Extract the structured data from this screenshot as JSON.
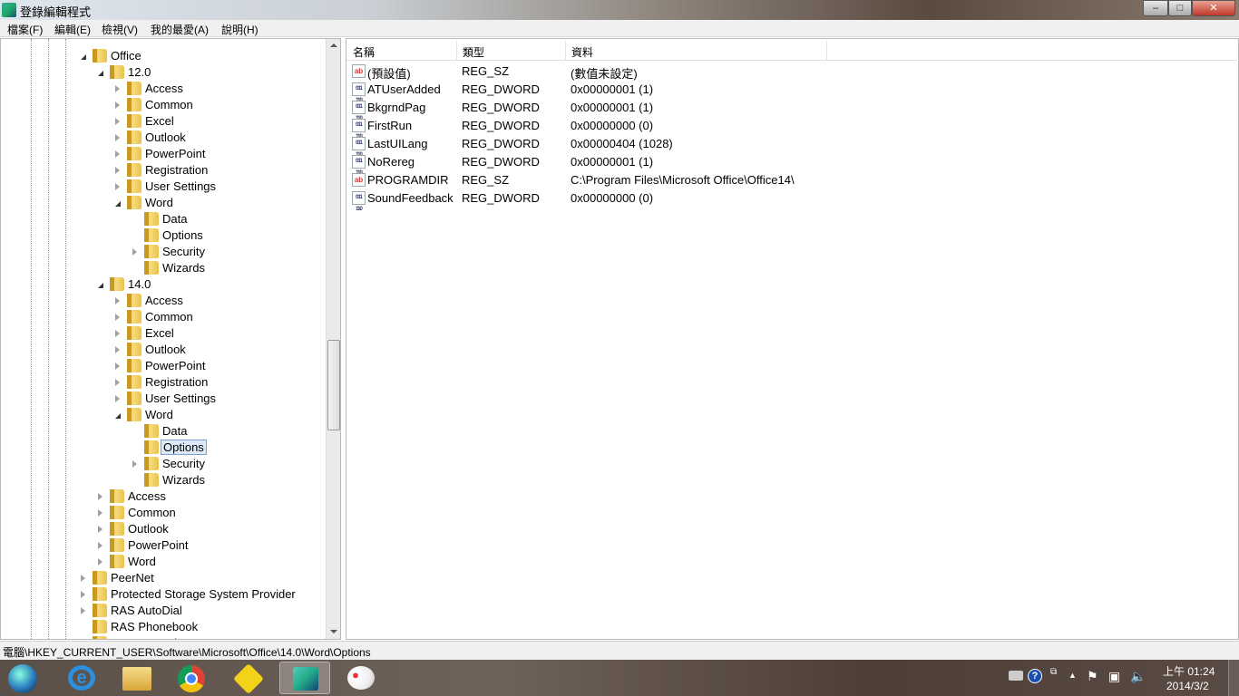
{
  "window": {
    "title": "登錄編輯程式",
    "minimize": "–",
    "maximize": "□",
    "close": "✕"
  },
  "menu": [
    "檔案(F)",
    "編輯(E)",
    "檢視(V)",
    "我的最愛(A)",
    "說明(H)"
  ],
  "tree": [
    {
      "label": "Office",
      "level": 0,
      "state": "e"
    },
    {
      "label": "12.0",
      "level": 1,
      "state": "e"
    },
    {
      "label": "Access",
      "level": 2,
      "state": "c"
    },
    {
      "label": "Common",
      "level": 2,
      "state": "c"
    },
    {
      "label": "Excel",
      "level": 2,
      "state": "c"
    },
    {
      "label": "Outlook",
      "level": 2,
      "state": "c"
    },
    {
      "label": "PowerPoint",
      "level": 2,
      "state": "c"
    },
    {
      "label": "Registration",
      "level": 2,
      "state": "c"
    },
    {
      "label": "User Settings",
      "level": 2,
      "state": "c"
    },
    {
      "label": "Word",
      "level": 2,
      "state": "e"
    },
    {
      "label": "Data",
      "level": 3,
      "state": ""
    },
    {
      "label": "Options",
      "level": 3,
      "state": ""
    },
    {
      "label": "Security",
      "level": 3,
      "state": "c"
    },
    {
      "label": "Wizards",
      "level": 3,
      "state": ""
    },
    {
      "label": "14.0",
      "level": 1,
      "state": "e"
    },
    {
      "label": "Access",
      "level": 2,
      "state": "c"
    },
    {
      "label": "Common",
      "level": 2,
      "state": "c"
    },
    {
      "label": "Excel",
      "level": 2,
      "state": "c"
    },
    {
      "label": "Outlook",
      "level": 2,
      "state": "c"
    },
    {
      "label": "PowerPoint",
      "level": 2,
      "state": "c"
    },
    {
      "label": "Registration",
      "level": 2,
      "state": "c"
    },
    {
      "label": "User Settings",
      "level": 2,
      "state": "c"
    },
    {
      "label": "Word",
      "level": 2,
      "state": "e"
    },
    {
      "label": "Data",
      "level": 3,
      "state": ""
    },
    {
      "label": "Options",
      "level": 3,
      "state": "",
      "selected": true
    },
    {
      "label": "Security",
      "level": 3,
      "state": "c"
    },
    {
      "label": "Wizards",
      "level": 3,
      "state": ""
    },
    {
      "label": "Access",
      "level": 1,
      "state": "c"
    },
    {
      "label": "Common",
      "level": 1,
      "state": "c"
    },
    {
      "label": "Outlook",
      "level": 1,
      "state": "c"
    },
    {
      "label": "PowerPoint",
      "level": 1,
      "state": "c"
    },
    {
      "label": "Word",
      "level": 1,
      "state": "c"
    },
    {
      "label": "PeerNet",
      "level": 0,
      "state": "c"
    },
    {
      "label": "Protected Storage System Provider",
      "level": 0,
      "state": "c"
    },
    {
      "label": "RAS AutoDial",
      "level": 0,
      "state": "c"
    },
    {
      "label": "RAS Phonebook",
      "level": 0,
      "state": ""
    },
    {
      "label": "Remote Assistance",
      "level": 0,
      "state": ""
    }
  ],
  "list": {
    "headers": [
      "名稱",
      "類型",
      "資料"
    ],
    "rows": [
      {
        "icon": "sz",
        "name": "(預設值)",
        "type": "REG_SZ",
        "data": "(數值未設定)"
      },
      {
        "icon": "dw",
        "name": "ATUserAdded",
        "type": "REG_DWORD",
        "data": "0x00000001 (1)"
      },
      {
        "icon": "dw",
        "name": "BkgrndPag",
        "type": "REG_DWORD",
        "data": "0x00000001 (1)"
      },
      {
        "icon": "dw",
        "name": "FirstRun",
        "type": "REG_DWORD",
        "data": "0x00000000 (0)"
      },
      {
        "icon": "dw",
        "name": "LastUILang",
        "type": "REG_DWORD",
        "data": "0x00000404 (1028)"
      },
      {
        "icon": "dw",
        "name": "NoRereg",
        "type": "REG_DWORD",
        "data": "0x00000001 (1)"
      },
      {
        "icon": "sz",
        "name": "PROGRAMDIR",
        "type": "REG_SZ",
        "data": "C:\\Program Files\\Microsoft Office\\Office14\\"
      },
      {
        "icon": "dw",
        "name": "SoundFeedback",
        "type": "REG_DWORD",
        "data": "0x00000000 (0)"
      }
    ]
  },
  "icon_text": {
    "sz": "ab",
    "dw": "011 110"
  },
  "status": "電腦\\HKEY_CURRENT_USER\\Software\\Microsoft\\Office\\14.0\\Word\\Options",
  "clock": {
    "time": "上午 01:24",
    "date": "2014/3/2"
  }
}
